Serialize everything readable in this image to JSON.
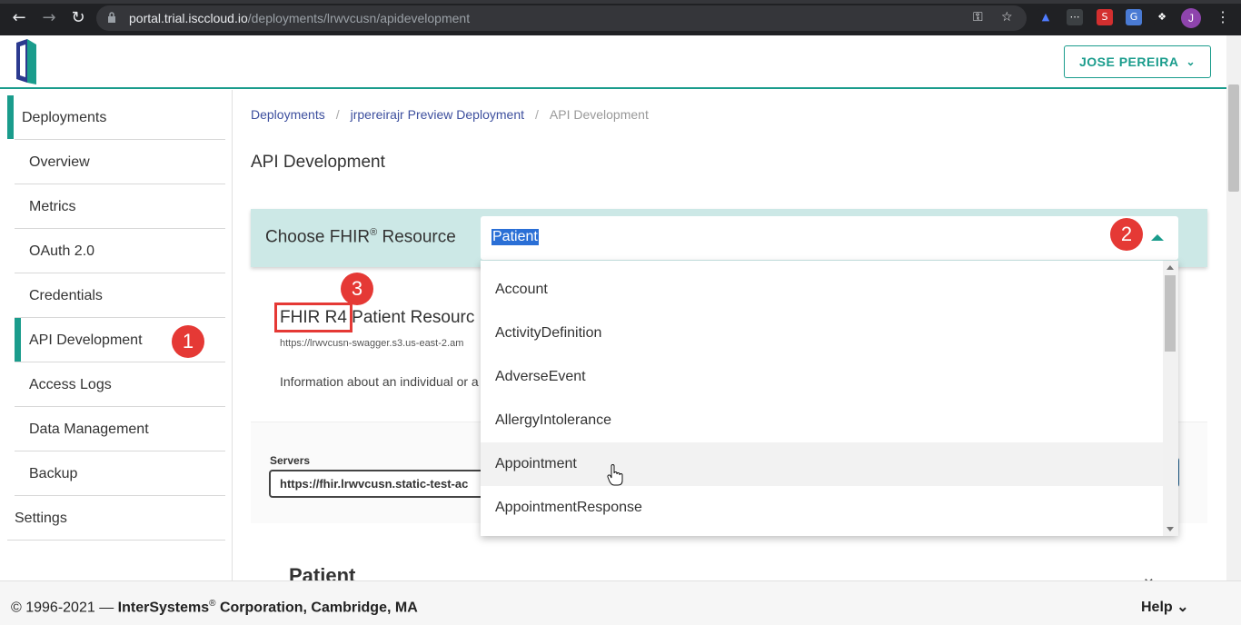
{
  "browser": {
    "url_host": "portal.trial.isccloud.io",
    "url_path": "/deployments/lrwvcusn/apidevelopment",
    "avatar_letter": "J"
  },
  "header": {
    "user_label": "JOSE PEREIRA"
  },
  "sidebar": {
    "items": [
      {
        "label": "Deployments"
      },
      {
        "label": "Overview"
      },
      {
        "label": "Metrics"
      },
      {
        "label": "OAuth 2.0"
      },
      {
        "label": "Credentials"
      },
      {
        "label": "API Development"
      },
      {
        "label": "Access Logs"
      },
      {
        "label": "Data Management"
      },
      {
        "label": "Backup"
      },
      {
        "label": "Settings"
      }
    ]
  },
  "breadcrumb": {
    "items": [
      "Deployments",
      "jrpereirajr Preview Deployment",
      "API Development"
    ]
  },
  "main": {
    "page_title": "API Development",
    "resource_label": "Choose FHIR",
    "resource_label_sup": "®",
    "resource_label_suffix": " Resource",
    "selected_resource": "Patient",
    "fhir_version": "FHIR R4",
    "resource_title_rest": " Patient Resourc",
    "swagger_url": "https://lrwvcusn-swagger.s3.us-east-2.am",
    "description": "Information about an individual or a",
    "servers_label": "Servers",
    "server_value": "https://fhir.lrwvcusn.static-test-ac",
    "section_title": "Patient"
  },
  "dropdown": {
    "options": [
      "Account",
      "ActivityDefinition",
      "AdverseEvent",
      "AllergyIntolerance",
      "Appointment",
      "AppointmentResponse"
    ],
    "hovered": "Appointment"
  },
  "callouts": [
    "1",
    "2",
    "3"
  ],
  "footer": {
    "copyright_prefix": "© 1996-2021 — ",
    "company": "InterSystems",
    "reg": "®",
    "company_suffix": " Corporation, Cambridge, MA",
    "help_label": "Help"
  },
  "colors": {
    "accent": "#1a9c8c",
    "callout": "#e53935",
    "link": "#3d4f9e"
  }
}
